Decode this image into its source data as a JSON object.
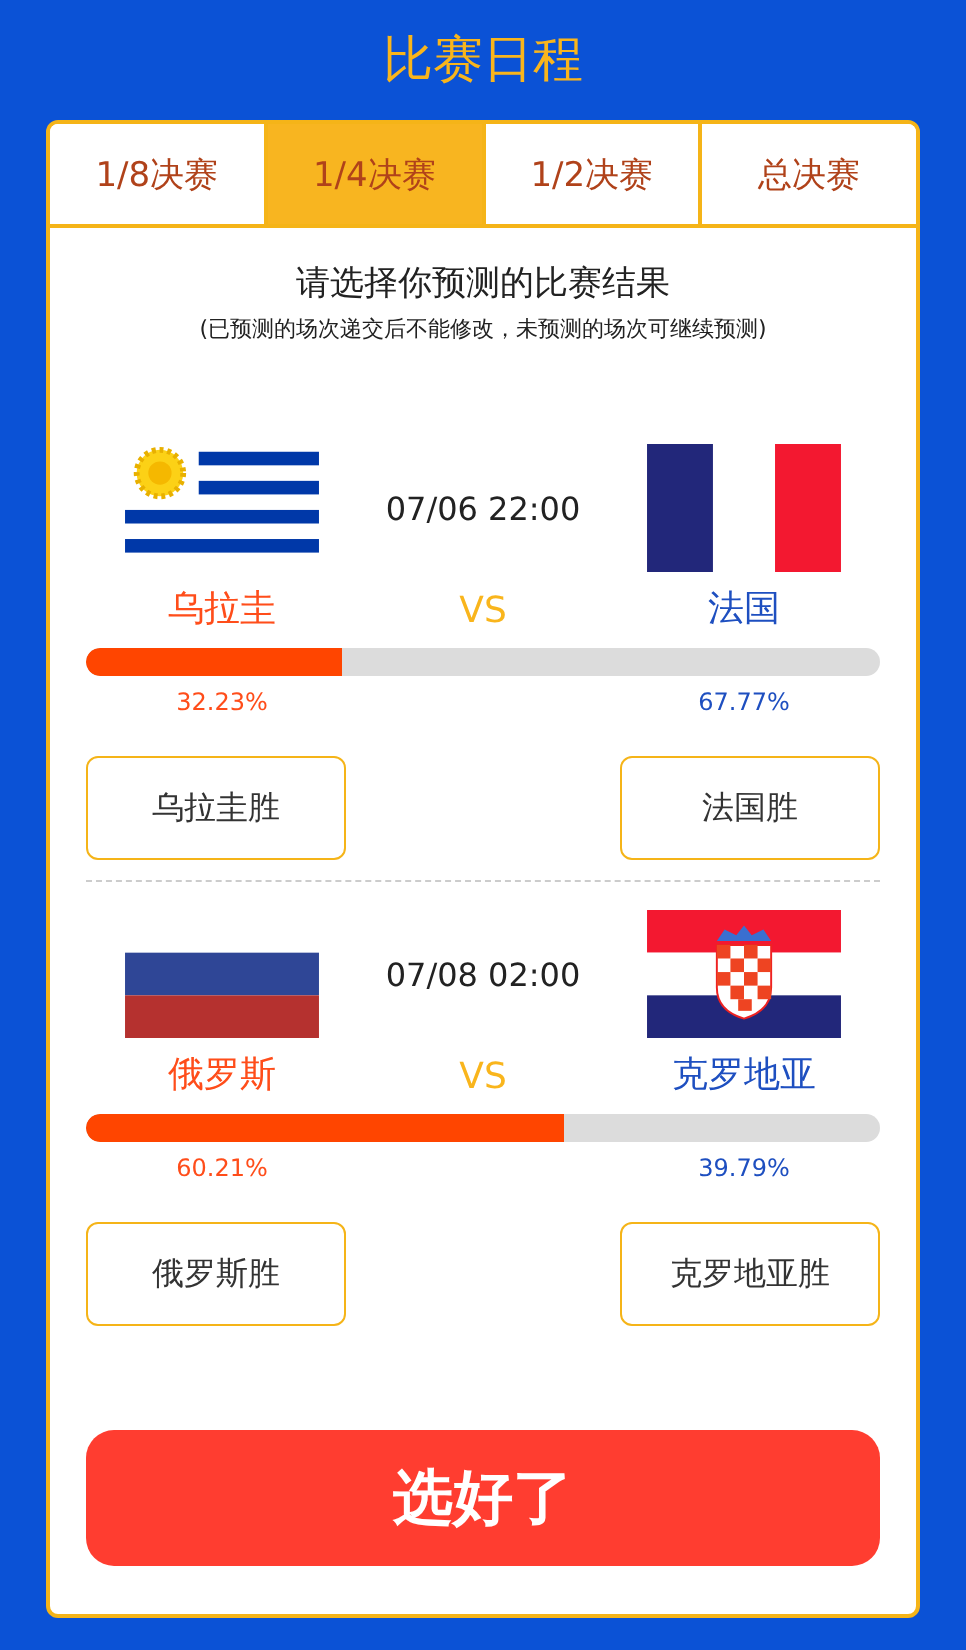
{
  "title": "比赛日程",
  "tabs": [
    {
      "label": "1/8决赛",
      "selected": false
    },
    {
      "label": "1/4决赛",
      "selected": true
    },
    {
      "label": "1/2决赛",
      "selected": false
    },
    {
      "label": "总决赛",
      "selected": false
    }
  ],
  "heading": "请选择你预测的比赛结果",
  "note": "(已预测的场次递交后不能修改，未预测的场次可继续预测)",
  "matches": [
    {
      "time": "07/06 22:00",
      "vs": "VS",
      "home": {
        "name": "乌拉圭",
        "kind": "uy",
        "percent": "32.23%",
        "button": "乌拉圭胜"
      },
      "away": {
        "name": "法国",
        "kind": "fr",
        "percent": "67.77%",
        "button": "法国胜"
      },
      "level": 0.3223
    },
    {
      "time": "07/08 02:00",
      "vs": "VS",
      "home": {
        "name": "俄罗斯",
        "kind": "ru",
        "percent": "60.21%",
        "button": "俄罗斯胜"
      },
      "away": {
        "name": "克罗地亚",
        "kind": "hr",
        "percent": "39.79%",
        "button": "克罗地亚胜"
      },
      "level": 0.6021
    }
  ],
  "submit": "选好了"
}
